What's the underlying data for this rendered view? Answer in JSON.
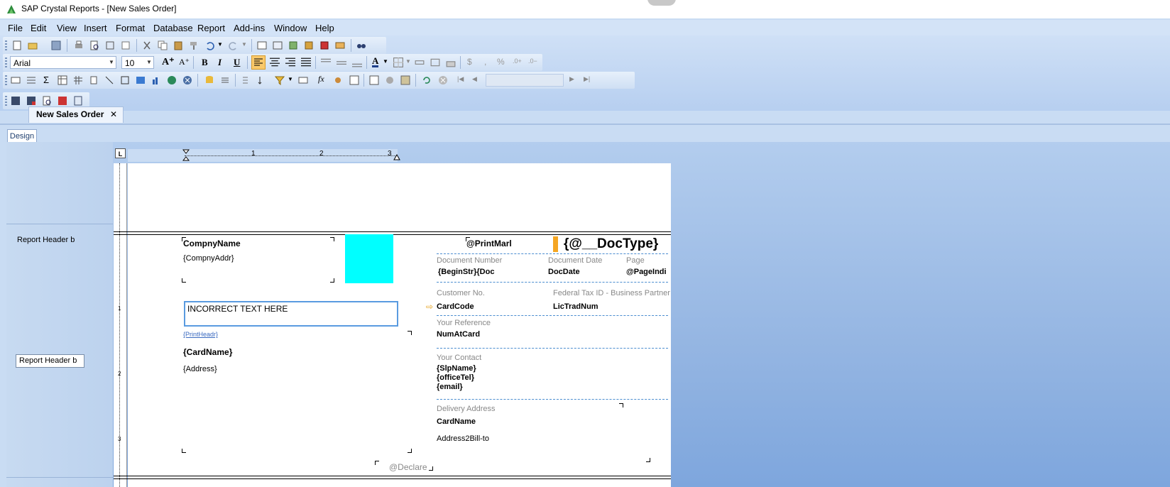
{
  "window": {
    "title": "SAP Crystal Reports - [New Sales Order]"
  },
  "menu": [
    "File",
    "Edit",
    "View",
    "Insert",
    "Format",
    "Database",
    "Report",
    "Add-ins",
    "Window",
    "Help"
  ],
  "format_toolbar": {
    "font": "Arial",
    "size": "10"
  },
  "tabs": {
    "document": "New Sales Order",
    "view": "Design"
  },
  "ruler": {
    "h": [
      "1",
      "2",
      "3"
    ],
    "v": [
      "1",
      "2",
      "3"
    ]
  },
  "sections": {
    "report_header_label": "Report Header b",
    "report_header_button": "Report Header b"
  },
  "report": {
    "company_name": "CompnyName",
    "company_addr": "{CompnyAddr}",
    "incorrect_text": "INCORRECT TEXT HERE",
    "print_headr": "{PrintHeadr}",
    "card_name": "{CardName}",
    "address": "{Address}",
    "print_mark": "@PrintMarl",
    "doc_type": "{@__DocType}",
    "doc_number_label": "Document Number",
    "doc_number_value": "{BeginStr}{Doc",
    "doc_date_label": "Document Date",
    "doc_date_value": "DocDate",
    "page_label": "Page",
    "page_value": "@PageIndi",
    "customer_no_label": "Customer No.",
    "customer_no_value": "CardCode",
    "tax_label": "Federal Tax ID - Business Partner",
    "tax_value": "LicTradNum",
    "your_ref_label": "Your Reference",
    "your_ref_value": "NumAtCard",
    "your_contact_label": "Your Contact",
    "contact_lines": [
      "{SlpName}",
      "{officeTel}",
      "{email}"
    ],
    "delivery_label": "Delivery Address",
    "delivery_name": "CardName",
    "delivery_addr": "Address2Bill-to",
    "declare": "@Declare"
  }
}
